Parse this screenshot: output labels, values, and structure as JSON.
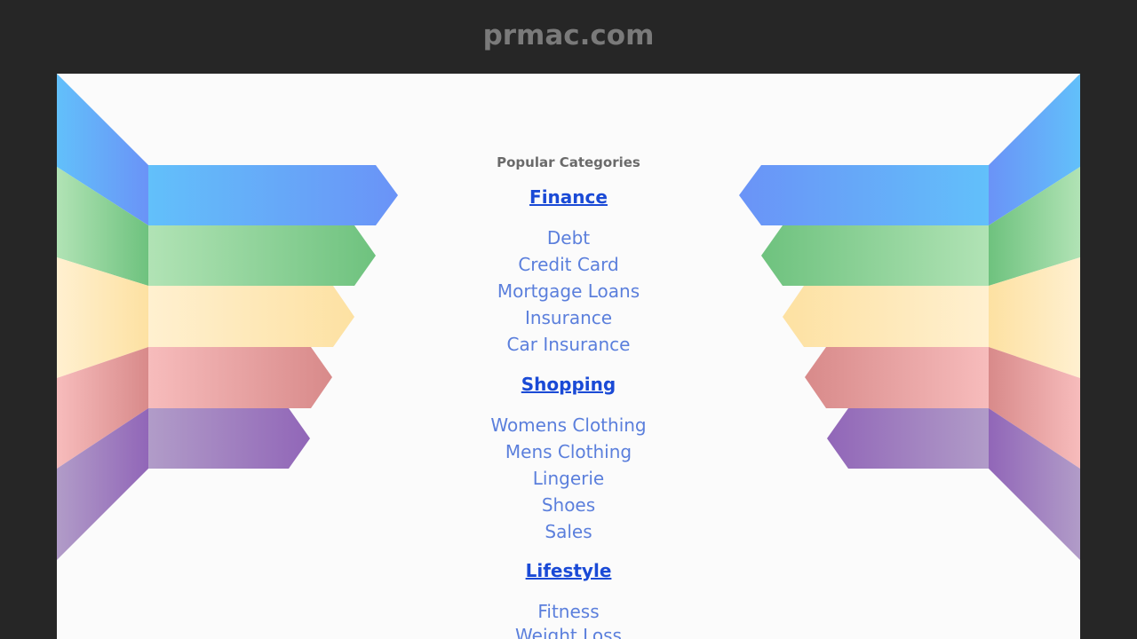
{
  "header": {
    "site_title": "prmac.com"
  },
  "colors": {
    "page_background": "#262626",
    "panel_background": "#fbfbfb",
    "heading_link": "#1a4ad6",
    "sub_link": "#5b7fdc",
    "ribbon_colors": [
      "#5aa8f5",
      "#7dcc8a",
      "#fde3a8",
      "#e9a0a0",
      "#a587c4"
    ]
  },
  "categories": {
    "heading": "Popular Categories",
    "groups": [
      {
        "label": "Finance",
        "items": [
          "Debt",
          "Credit Card",
          "Mortgage Loans",
          "Insurance",
          "Car Insurance"
        ]
      },
      {
        "label": "Shopping",
        "items": [
          "Womens Clothing",
          "Mens Clothing",
          "Lingerie",
          "Shoes",
          "Sales"
        ]
      },
      {
        "label": "Lifestyle",
        "items": [
          "Fitness",
          "Weight Loss"
        ]
      }
    ]
  }
}
